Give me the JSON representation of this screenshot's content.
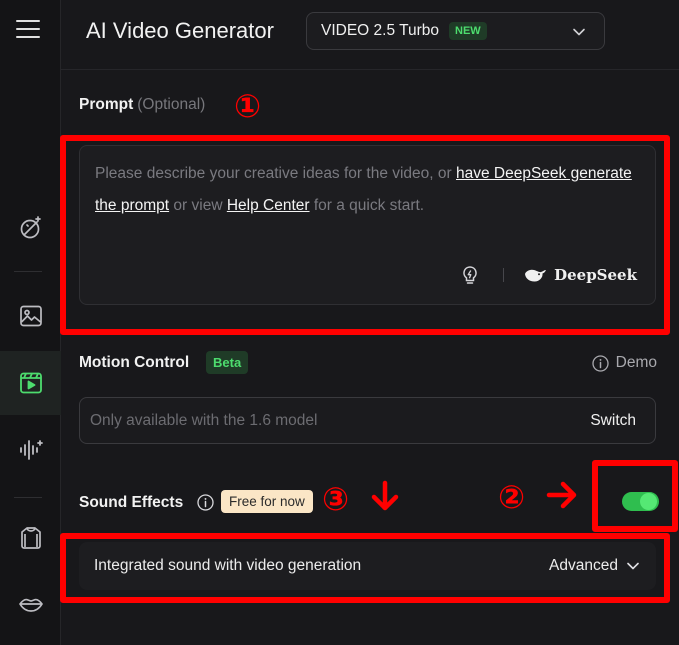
{
  "app": {
    "title": "AI Video Generator",
    "model": "VIDEO 2.5 Turbo",
    "model_badge": "NEW"
  },
  "sidebar": {
    "icons": [
      "menu-icon",
      "magic-wand-icon",
      "image-icon",
      "video-icon",
      "audio-wave-icon",
      "shirt-icon",
      "lips-icon"
    ],
    "active": "video-icon"
  },
  "prompt": {
    "label": "Prompt",
    "optional": "(Optional)",
    "placeholder_start": "Please describe your creative ideas for the video, or ",
    "link_deepseek": "have DeepSeek generate the prompt",
    "placeholder_mid": " or view ",
    "link_help": "Help Center",
    "placeholder_end": " for a quick start.",
    "deepseek_label": "DeepSeek"
  },
  "motion_control": {
    "label": "Motion Control",
    "badge": "Beta",
    "demo": "Demo",
    "placeholder": "Only available with the 1.6 model",
    "switch_label": "Switch"
  },
  "sound_effects": {
    "label": "Sound Effects",
    "badge": "Free for now",
    "enabled": true,
    "row_text": "Integrated sound with video generation",
    "advanced_label": "Advanced"
  },
  "annotations": {
    "color": "#ff0000",
    "markers": [
      "①",
      "②",
      "③"
    ]
  },
  "colors": {
    "accent_green": "#4ddc6e",
    "toggle_on": "#2fbe4f",
    "background": "#18181b"
  }
}
